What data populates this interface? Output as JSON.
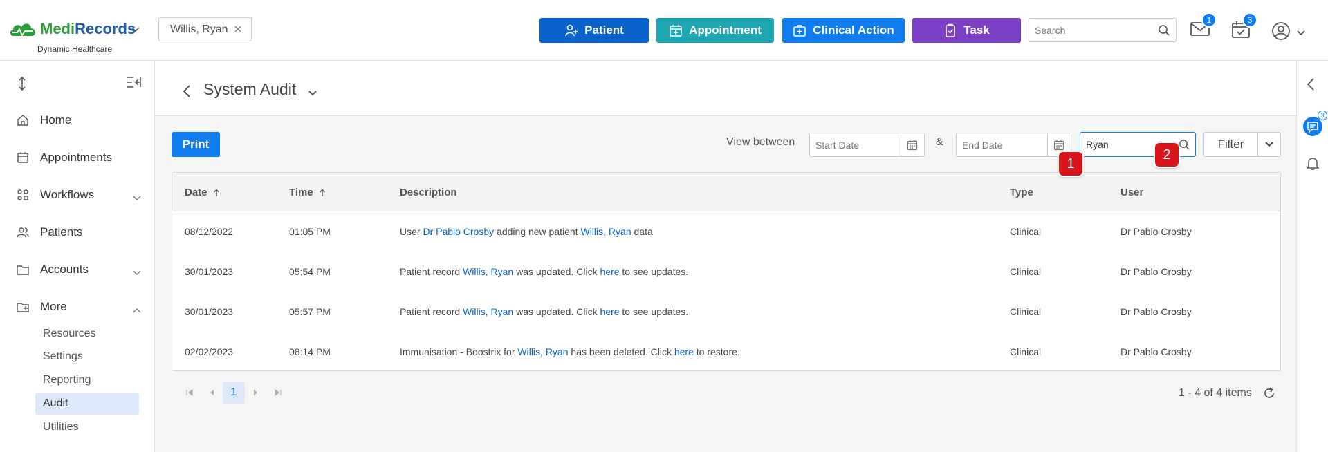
{
  "app": {
    "logo_text_1": "Medi",
    "logo_text_2": "Records",
    "subtitle": "Dynamic Healthcare"
  },
  "patient_chip": {
    "label": "Willis, Ryan"
  },
  "quick_actions": [
    {
      "label": "Patient",
      "icon": "add-person-icon",
      "color": "#0a62cc"
    },
    {
      "label": "Appointment",
      "icon": "calendar-plus-icon",
      "color": "#1ea6b2"
    },
    {
      "label": "Clinical Action",
      "icon": "medical-bag-icon",
      "color": "#0f7cf0"
    },
    {
      "label": "Task",
      "icon": "clipboard-check-icon",
      "color": "#7b3fc6"
    }
  ],
  "top_search": {
    "placeholder": "Search"
  },
  "notifications": {
    "mail_count": "1",
    "calendar_count": "3"
  },
  "sidebar": {
    "items": [
      {
        "label": "Home",
        "icon": "home-icon"
      },
      {
        "label": "Appointments",
        "icon": "calendar-icon"
      },
      {
        "label": "Workflows",
        "icon": "workflow-icon"
      },
      {
        "label": "Patients",
        "icon": "people-icon"
      },
      {
        "label": "Accounts",
        "icon": "folder-icon"
      },
      {
        "label": "More",
        "icon": "folder-plus-icon"
      }
    ],
    "sub_items": [
      "Resources",
      "Settings",
      "Reporting",
      "Audit",
      "Utilities"
    ],
    "active_sub": "Audit"
  },
  "right_rail": {
    "chat_badge": "3"
  },
  "page": {
    "title": "System Audit"
  },
  "toolbar": {
    "print_label": "Print",
    "view_between_label": "View between",
    "start_placeholder": "Start Date",
    "amp": "&",
    "end_placeholder": "End Date",
    "search_value": "Ryan",
    "filter_label": "Filter"
  },
  "markers": [
    "1",
    "2"
  ],
  "table": {
    "headers": {
      "date": "Date",
      "time": "Time",
      "description": "Description",
      "type": "Type",
      "user": "User"
    },
    "rows": [
      {
        "date": "08/12/2022",
        "time": "01:05 PM",
        "d": [
          "User ",
          "Dr Pablo Crosby",
          " adding new patient ",
          "Willis, Ryan",
          " data"
        ],
        "type": "Clinical",
        "user": "Dr Pablo Crosby"
      },
      {
        "date": "30/01/2023",
        "time": "05:54 PM",
        "d": [
          "Patient record ",
          "Willis, Ryan",
          " was updated. Click ",
          "here",
          " to see updates."
        ],
        "type": "Clinical",
        "user": "Dr Pablo Crosby"
      },
      {
        "date": "30/01/2023",
        "time": "05:57 PM",
        "d": [
          "Patient record ",
          "Willis, Ryan",
          " was updated. Click ",
          "here",
          " to see updates."
        ],
        "type": "Clinical",
        "user": "Dr Pablo Crosby"
      },
      {
        "date": "02/02/2023",
        "time": "08:14 PM",
        "d": [
          "Immunisation - Boostrix for ",
          "Willis, Ryan",
          " has been deleted. Click ",
          "here",
          " to restore."
        ],
        "type": "Clinical",
        "user": "Dr Pablo Crosby"
      }
    ]
  },
  "pager": {
    "current_page": "1",
    "items_label": "1 - 4 of 4 items"
  }
}
